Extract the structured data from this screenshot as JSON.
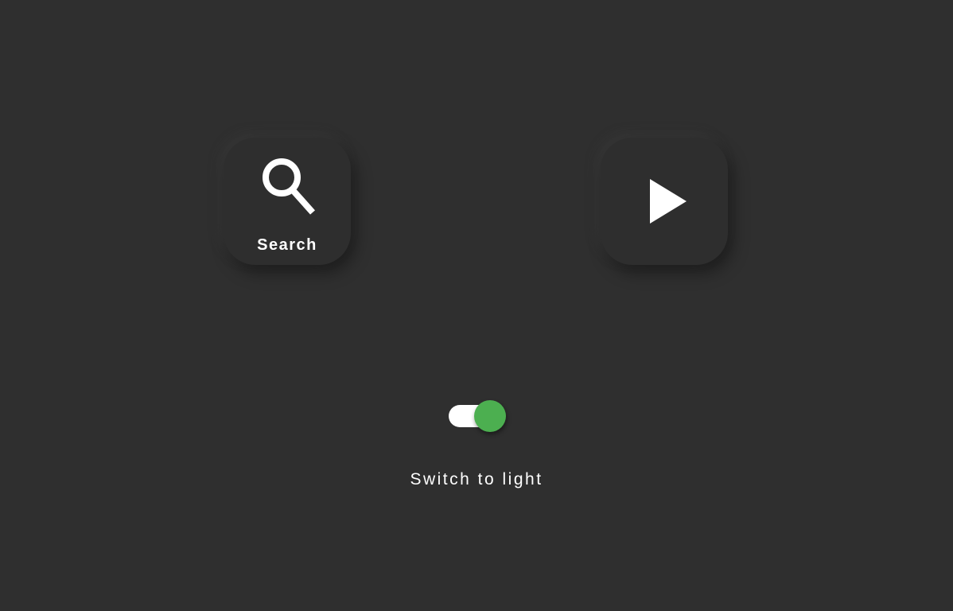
{
  "buttons": {
    "search": {
      "label": "Search",
      "icon": "search-icon"
    },
    "play": {
      "icon": "play-icon"
    }
  },
  "theme_toggle": {
    "state": "on",
    "label": "Switch to light"
  },
  "colors": {
    "background": "#2f2f2f",
    "tile": "#2e2e2e",
    "icon": "#ffffff",
    "toggle_track": "#ffffff",
    "toggle_knob": "#4caf50"
  }
}
